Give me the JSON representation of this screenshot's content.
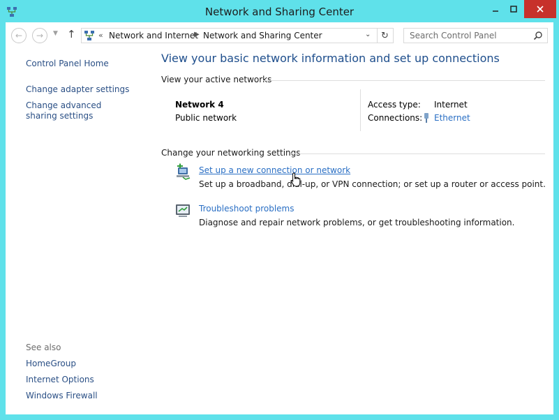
{
  "window": {
    "title": "Network and Sharing Center",
    "controls": {
      "minimize": "minimize",
      "maximize": "maximize",
      "close": "close"
    }
  },
  "toolbar": {
    "back_icon": "back-arrow-icon",
    "forward_icon": "forward-arrow-icon",
    "up_icon": "up-arrow-icon",
    "address": {
      "chevron": "«",
      "crumbs": [
        "Network and Internet",
        "Network and Sharing Center"
      ]
    },
    "search_placeholder": "Search Control Panel"
  },
  "sidebar": {
    "items": [
      {
        "label": "Control Panel Home"
      },
      {
        "label": "Change adapter settings"
      },
      {
        "label": "Change advanced sharing settings"
      }
    ],
    "see_also": {
      "heading": "See also",
      "items": [
        "HomeGroup",
        "Internet Options",
        "Windows Firewall"
      ]
    }
  },
  "main": {
    "title": "View your basic network information and set up connections",
    "active_networks": {
      "heading": "View your active networks",
      "network_name": "Network  4",
      "network_type": "Public network",
      "access_type_label": "Access type:",
      "access_type_value": "Internet",
      "connections_label": "Connections:",
      "connections_value": "Ethernet"
    },
    "settings": {
      "heading": "Change your networking settings",
      "tasks": [
        {
          "link": "Set up a new connection or network",
          "description": "Set up a broadband, dial-up, or VPN connection; or set up a router or access point."
        },
        {
          "link": "Troubleshoot problems",
          "description": "Diagnose and repair network problems, or get troubleshooting information."
        }
      ]
    }
  },
  "colors": {
    "frame": "#5fe1ea",
    "link": "#2a6fc4",
    "title_blue": "#1e4e8c",
    "close_button": "#c7312b"
  }
}
